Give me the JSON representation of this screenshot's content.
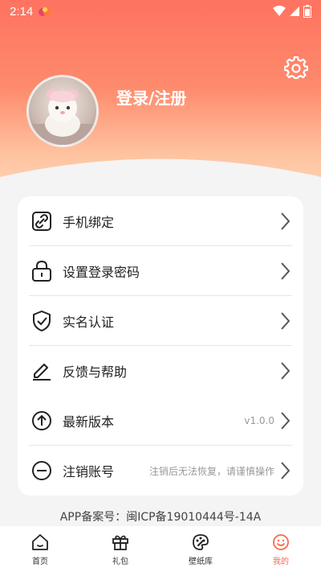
{
  "status_bar": {
    "time": "2:14"
  },
  "header": {
    "login_label": "登录/注册"
  },
  "menu": {
    "items": [
      {
        "label": "手机绑定",
        "icon": "link-icon",
        "value": ""
      },
      {
        "label": "设置登录密码",
        "icon": "lock-icon",
        "value": ""
      },
      {
        "label": "实名认证",
        "icon": "shield-check-icon",
        "value": ""
      },
      {
        "label": "反馈与帮助",
        "icon": "edit-icon",
        "value": ""
      },
      {
        "label": "最新版本",
        "icon": "arrow-up-circle-icon",
        "value": "v1.0.0"
      },
      {
        "label": "注销账号",
        "icon": "minus-circle-icon",
        "value": "注销后无法恢复，请谨慎操作"
      }
    ]
  },
  "footer": {
    "icp": "APP备案号：闽ICP备19010444号-14A"
  },
  "bottom_nav": {
    "items": [
      {
        "label": "首页",
        "icon": "home-icon"
      },
      {
        "label": "礼包",
        "icon": "gift-icon"
      },
      {
        "label": "壁纸库",
        "icon": "palette-icon"
      },
      {
        "label": "我的",
        "icon": "smile-icon"
      }
    ],
    "active_index": 3
  },
  "colors": {
    "header_top": "#fe7361",
    "header_bottom": "#fdd3b4",
    "accent": "#f66a4c",
    "page_bg": "#f4f4f4"
  }
}
